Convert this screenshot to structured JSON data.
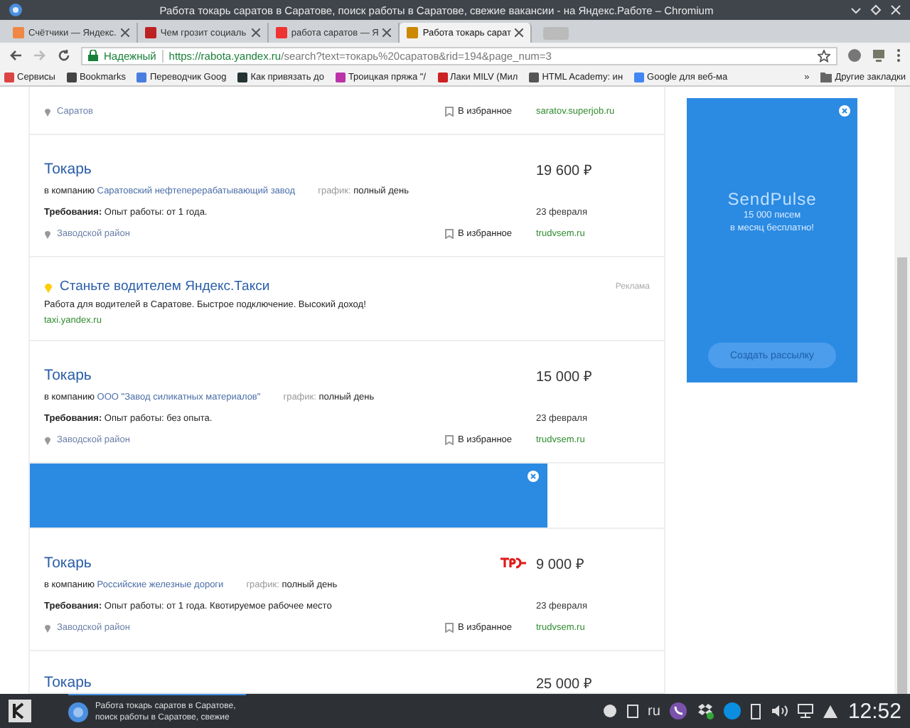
{
  "window": {
    "title": "Работа токарь саратов в Саратове, поиск работы в Саратове, свежие вакансии - на Яндекс.Работе – Chromium"
  },
  "tabs": [
    {
      "title": "Счётчики — Яндекс.",
      "selected": false
    },
    {
      "title": "Чем грозит социаль",
      "selected": false
    },
    {
      "title": "работа саратов — Я",
      "selected": false
    },
    {
      "title": "Работа токарь сарат",
      "selected": true
    }
  ],
  "address_bar": {
    "security": "Надежный",
    "url_host": "https://rabota.yandex.ru",
    "url_path": "/search?text=токарь%20саратов&rid=194&page_num=3"
  },
  "bookmarks": [
    "Сервисы",
    "Bookmarks",
    "Переводчик Goog",
    "Как привязать до",
    "Троицкая пряжа \"/",
    "Лаки MILV (Мил",
    "HTML Academy: ин",
    "Google для веб-ма"
  ],
  "bookmarks_more": "»",
  "other_bookmarks": "Другие закладки",
  "listings": [
    {
      "kind": "vacancy",
      "location": "Саратов",
      "favorite": "В избранное",
      "source": "saratov.superjob.ru"
    },
    {
      "kind": "vacancy",
      "title": "Токарь",
      "salary": "19 600 ₽",
      "company_prefix": "в компанию",
      "company": "Саратовский нефтеперерабатывающий завод",
      "schedule_label": "график:",
      "schedule": "полный день",
      "requirements_label": "Требования:",
      "requirements": "Опыт работы: от 1 года.",
      "date": "23 февраля",
      "location": "Заводской район",
      "favorite": "В избранное",
      "source": "trudvsem.ru"
    },
    {
      "kind": "ad",
      "title": "Станьте водителем Яндекс.Такси",
      "text": "Работа для водителей в Саратове. Быстрое подключение. Высокий доход!",
      "url": "taxi.yandex.ru",
      "label": "Реклама"
    },
    {
      "kind": "vacancy",
      "title": "Токарь",
      "salary": "15 000 ₽",
      "company_prefix": "в компанию",
      "company": "ООО \"Завод силикатных материалов\"",
      "schedule_label": "график:",
      "schedule": "полный день",
      "requirements_label": "Требования:",
      "requirements": "Опыт работы: без опыта.",
      "date": "23 февраля",
      "location": "Заводской район",
      "favorite": "В избранное",
      "source": "trudvsem.ru"
    },
    {
      "kind": "banner"
    },
    {
      "kind": "vacancy",
      "title": "Токарь",
      "salary": "9 000 ₽",
      "company_prefix": "в компанию",
      "company": "Российские железные дороги",
      "schedule_label": "график:",
      "schedule": "полный день",
      "requirements_label": "Требования:",
      "requirements": "Опыт работы: от 1 года. Квотируемое рабочее место",
      "date": "23 февраля",
      "location": "Заводской район",
      "favorite": "В избранное",
      "source": "trudvsem.ru",
      "has_logo": true
    },
    {
      "kind": "vacancy",
      "title": "Токарь",
      "salary": "25 000 ₽"
    }
  ],
  "side_ad": {
    "brand": "SendPulse",
    "line1": "15 000 писем",
    "line2": "в месяц бесплатно!",
    "button": "Создать рассылку"
  },
  "taskbar": {
    "task_line1": "Работа токарь саратов в Саратове,",
    "task_line2": "поиск работы в Саратове, свежие",
    "language": "ru",
    "time": "12:52"
  }
}
